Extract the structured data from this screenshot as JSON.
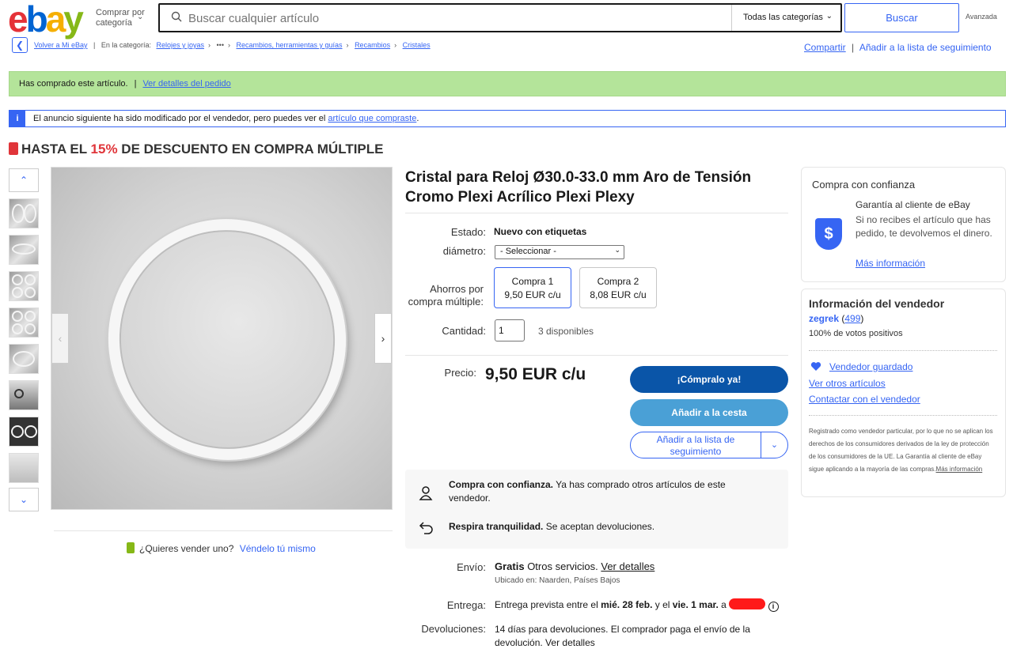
{
  "header": {
    "shop_by_category": "Comprar por categoría",
    "search_placeholder": "Buscar cualquier artículo",
    "category_select": "Todas las categorías",
    "search_button": "Buscar",
    "advanced": "Avanzada"
  },
  "breadcrumb": {
    "back": "Volver a Mi eBay",
    "in_category": "En la categoría:",
    "items": [
      "Relojes y joyas",
      "•••",
      "Recambios, herramientas y guías",
      "Recambios",
      "Cristales"
    ]
  },
  "share": {
    "share_label": "Compartir",
    "watchlist_label": "Añadir a la lista de seguimiento"
  },
  "purchased_banner": {
    "text": "Has comprado este artículo.",
    "link": "Ver detalles del pedido"
  },
  "info_banner": {
    "text_before": "El anuncio siguiente ha sido modificado por el vendedor, pero puedes ver el ",
    "link": "artículo que compraste",
    "text_after": "."
  },
  "promo": {
    "prefix": "HASTA EL ",
    "percent": "15%",
    "suffix": " DE DESCUENTO EN COMPRA MÚLTIPLE"
  },
  "gallery": {
    "sell_question": "¿Quieres vender uno?",
    "sell_link": "Véndelo tú mismo"
  },
  "item": {
    "title": "Cristal para Reloj Ø30.0-33.0 mm Aro de Tensión Cromo Plexi Acrílico Plexi Plexy",
    "condition_label": "Estado:",
    "condition_value": "Nuevo con etiquetas",
    "diameter_label": "diámetro:",
    "diameter_value": "- Seleccionar -",
    "multibuy_label": "Ahorros por compra múltiple:",
    "multibuy_options": [
      {
        "name": "Compra 1",
        "price": "9,50 EUR c/u"
      },
      {
        "name": "Compra 2",
        "price": "8,08 EUR c/u"
      }
    ],
    "quantity_label": "Cantidad:",
    "quantity_value": "1",
    "available": "3 disponibles",
    "price_label": "Precio:",
    "price": "9,50 EUR c/u",
    "buy_now": "¡Cómpralo ya!",
    "add_to_cart": "Añadir a la cesta",
    "add_to_watchlist": "Añadir a la lista de seguimiento"
  },
  "trust": {
    "row1_bold": "Compra con confianza.",
    "row1_text": " Ya has comprado otros artículos de este vendedor.",
    "row2_bold": "Respira tranquilidad.",
    "row2_text": " Se aceptan devoluciones."
  },
  "shipping": {
    "label": "Envío:",
    "free": "Gratis",
    "service": " Otros servicios. ",
    "details": "Ver detalles",
    "location": "Ubicado en: Naarden, Países Bajos"
  },
  "delivery": {
    "label": "Entrega:",
    "text1": "Entrega prevista entre el ",
    "date1": "mié. 28 feb.",
    "text2": " y el ",
    "date2": "vie. 1 mar.",
    "text3": " a"
  },
  "returns": {
    "label": "Devoluciones:",
    "text": "14 días para devoluciones. El comprador paga el envío de la devolución. ",
    "details": "Ver detalles"
  },
  "guarantee": {
    "title": "Compra con confianza",
    "heading": "Garantía al cliente de eBay",
    "text": "Si no recibes el artículo que has pedido, te devolvemos el dinero.",
    "link": "Más información"
  },
  "seller": {
    "title": "Información del vendedor",
    "name": "zegrek",
    "score": "499",
    "positive": "100% de votos positivos",
    "saved": "Vendedor guardado",
    "other_items": "Ver otros artículos",
    "contact": "Contactar con el vendedor",
    "disclaimer": "Registrado como vendedor particular, por lo que no se aplican los derechos de los consumidores derivados de la ley de protección de los consumidores de la UE. La Garantía al cliente de eBay sigue aplicando a la mayoría de las compras.",
    "disclaimer_link": "Más información"
  },
  "colors": {
    "accent": "#3665f3",
    "buy": "#0a55a8",
    "cart": "#4aa0d6",
    "banner": "#b4e49a",
    "promo_red": "#e0353a"
  }
}
